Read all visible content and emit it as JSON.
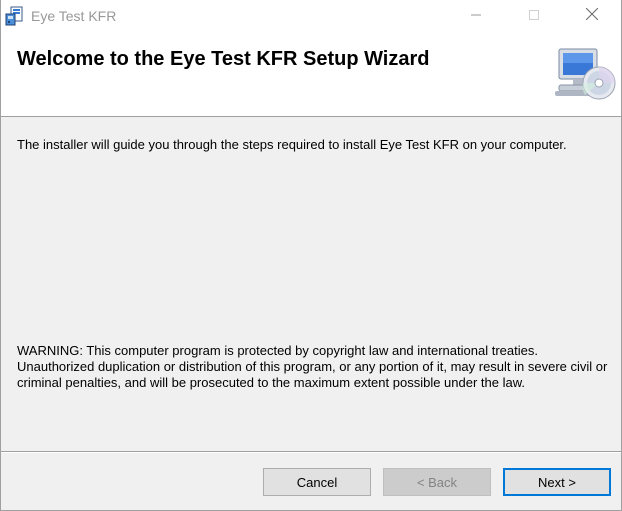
{
  "window": {
    "title": "Eye Test KFR",
    "minimize_icon": "minimize-icon",
    "maximize_icon": "maximize-icon",
    "close_icon": "close-icon",
    "app_icon": "installer-app-icon"
  },
  "banner": {
    "title": "Welcome to the Eye Test KFR Setup Wizard",
    "icon": "computer-disc-icon"
  },
  "content": {
    "intro": "The installer will guide you through the steps required to install Eye Test KFR on your computer.",
    "warning": "WARNING: This computer program is protected by copyright law and international treaties. Unauthorized duplication or distribution of this program, or any portion of it, may result in severe civil or criminal penalties, and will be prosecuted to the maximum extent possible under the law."
  },
  "buttons": {
    "cancel": "Cancel",
    "back": "< Back",
    "next": "Next >"
  },
  "colors": {
    "accent": "#0078d7",
    "window_bg": "#f0f0f0",
    "banner_bg": "#ffffff"
  }
}
